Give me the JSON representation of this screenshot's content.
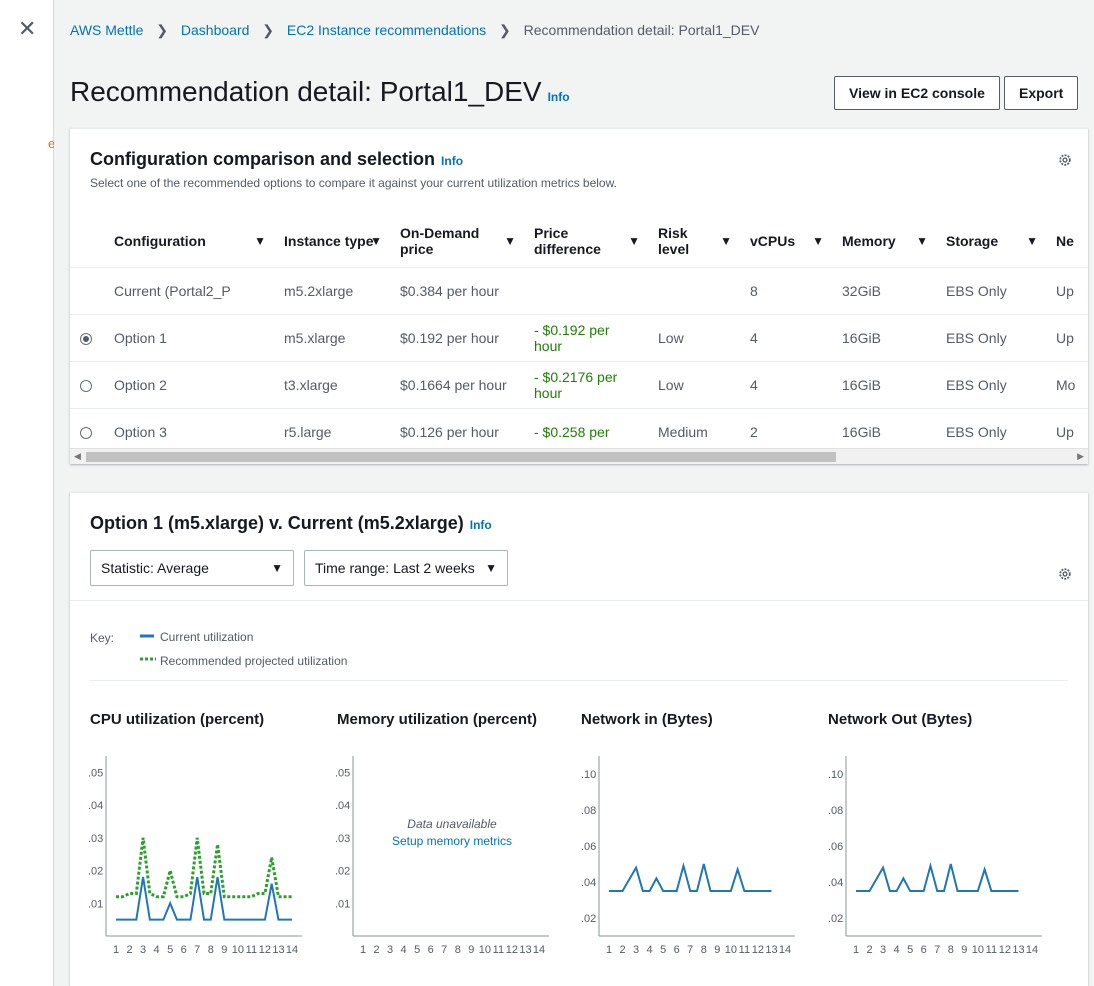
{
  "nav": {
    "close_glyph": "✕",
    "fragment": "e"
  },
  "breadcrumb": [
    "AWS Mettle",
    "Dashboard",
    "EC2 Instance recommendations",
    "Recommendation detail: Portal1_DEV"
  ],
  "page": {
    "title": "Recommendation detail: Portal1_DEV",
    "info": "Info",
    "view_button": "View in EC2 console",
    "export_button": "Export"
  },
  "config": {
    "title": "Configuration comparison and selection",
    "info": "Info",
    "description": "Select one of the recommended options to compare it against your current utilization metrics below.",
    "columns": [
      "Configuration",
      "Instance type",
      "On-Demand price",
      "Price difference",
      "Risk level",
      "vCPUs",
      "Memory",
      "Storage",
      "Ne"
    ],
    "rows": [
      {
        "radio": "none",
        "cells": [
          "Current (Portal2_P",
          "m5.2xlarge",
          "$0.384 per hour",
          "",
          "",
          "8",
          "32GiB",
          "EBS Only",
          "Up"
        ]
      },
      {
        "radio": "selected",
        "cells": [
          "Option 1",
          "m5.xlarge",
          "$0.192 per hour",
          "- $0.192 per hour",
          "Low",
          "4",
          "16GiB",
          "EBS Only",
          "Up"
        ]
      },
      {
        "radio": "unselected",
        "cells": [
          "Option 2",
          "t3.xlarge",
          "$0.1664 per hour",
          "- $0.2176 per hour",
          "Low",
          "4",
          "16GiB",
          "EBS Only",
          "Mo"
        ]
      },
      {
        "radio": "unselected",
        "cells": [
          "Option 3",
          "r5.large",
          "$0.126 per hour",
          "- $0.258 per",
          "Medium",
          "2",
          "16GiB",
          "EBS Only",
          "Up"
        ]
      }
    ]
  },
  "compare": {
    "title": "Option 1 (m5.xlarge) v. Current (m5.2xlarge)",
    "info": "Info",
    "statistic": "Statistic: Average",
    "time_range": "Time range: Last 2 weeks",
    "key_label": "Key:",
    "key_current": "Current utilization",
    "key_recommended": "Recommended projected utilization",
    "colors": {
      "current": "#1f77b4",
      "recommended": "#2ca02c"
    },
    "no_data": "Data unavailable",
    "setup_link": "Setup memory metrics"
  },
  "chart_data": [
    {
      "type": "line",
      "title": "CPU utilization (percent)",
      "x": [
        1,
        1.5,
        2,
        2.5,
        3,
        3.5,
        4,
        4.5,
        5,
        5.5,
        6,
        6.5,
        7,
        7.5,
        8,
        8.5,
        9,
        9.5,
        10,
        10.5,
        11,
        11.5,
        12,
        12.5,
        13,
        13.5,
        14
      ],
      "ylim": [
        0,
        0.055
      ],
      "yticks": [
        ".05",
        ".04",
        ".03",
        ".02",
        ".01"
      ],
      "ytick_values": [
        0.05,
        0.04,
        0.03,
        0.02,
        0.01
      ],
      "xticks": [
        "1",
        "2",
        "3",
        "4",
        "5",
        "6",
        "7",
        "8",
        "9",
        "10",
        "11",
        "12",
        "13",
        "14"
      ],
      "series": [
        {
          "name": "Current utilization",
          "values": [
            0.005,
            0.005,
            0.005,
            0.005,
            0.018,
            0.005,
            0.005,
            0.005,
            0.01,
            0.005,
            0.005,
            0.005,
            0.018,
            0.005,
            0.005,
            0.018,
            0.005,
            0.005,
            0.005,
            0.005,
            0.005,
            0.005,
            0.005,
            0.016,
            0.005,
            0.005,
            0.005
          ]
        },
        {
          "name": "Recommended projected utilization",
          "values": [
            0.012,
            0.012,
            0.013,
            0.013,
            0.03,
            0.013,
            0.012,
            0.012,
            0.02,
            0.012,
            0.012,
            0.013,
            0.03,
            0.013,
            0.013,
            0.028,
            0.012,
            0.012,
            0.012,
            0.012,
            0.012,
            0.013,
            0.013,
            0.024,
            0.012,
            0.012,
            0.012
          ]
        }
      ]
    },
    {
      "type": "line",
      "title": "Memory utilization (percent)",
      "ylim": [
        0,
        0.055
      ],
      "yticks": [
        ".05",
        ".04",
        ".03",
        ".02",
        ".01"
      ],
      "ytick_values": [
        0.05,
        0.04,
        0.03,
        0.02,
        0.01
      ],
      "xticks": [
        "1",
        "2",
        "3",
        "4",
        "5",
        "6",
        "7",
        "8",
        "9",
        "10",
        "11",
        "12",
        "13",
        "14"
      ],
      "series": []
    },
    {
      "type": "line",
      "title": "Network in (Bytes)",
      "x": [
        1,
        2,
        3,
        3.5,
        4,
        4.5,
        5,
        6,
        6.5,
        7,
        7.5,
        8,
        8.5,
        9,
        10,
        10.5,
        11,
        12,
        13
      ],
      "ylim": [
        0.01,
        0.11
      ],
      "yticks": [
        ".10",
        ".08",
        ".06",
        ".04",
        ".02"
      ],
      "ytick_values": [
        0.1,
        0.08,
        0.06,
        0.04,
        0.02
      ],
      "xticks": [
        "1",
        "2",
        "3",
        "4",
        "5",
        "6",
        "7",
        "8",
        "9",
        "10",
        "11",
        "12",
        "13",
        "14"
      ],
      "series": [
        {
          "name": "Current utilization",
          "values": [
            0.035,
            0.035,
            0.048,
            0.035,
            0.035,
            0.042,
            0.035,
            0.035,
            0.049,
            0.035,
            0.035,
            0.05,
            0.035,
            0.035,
            0.035,
            0.047,
            0.035,
            0.035,
            0.035
          ]
        }
      ]
    },
    {
      "type": "line",
      "title": "Network Out (Bytes)",
      "x": [
        1,
        2,
        3,
        3.5,
        4,
        4.5,
        5,
        6,
        6.5,
        7,
        7.5,
        8,
        8.5,
        9,
        10,
        10.5,
        11,
        12,
        13
      ],
      "ylim": [
        0.01,
        0.11
      ],
      "yticks": [
        ".10",
        ".08",
        ".06",
        ".04",
        ".02"
      ],
      "ytick_values": [
        0.1,
        0.08,
        0.06,
        0.04,
        0.02
      ],
      "xticks": [
        "1",
        "2",
        "3",
        "4",
        "5",
        "6",
        "7",
        "8",
        "9",
        "10",
        "11",
        "12",
        "13",
        "14"
      ],
      "series": [
        {
          "name": "Current utilization",
          "values": [
            0.035,
            0.035,
            0.048,
            0.035,
            0.035,
            0.042,
            0.035,
            0.035,
            0.049,
            0.035,
            0.035,
            0.05,
            0.035,
            0.035,
            0.035,
            0.047,
            0.035,
            0.035,
            0.035
          ]
        }
      ]
    }
  ]
}
